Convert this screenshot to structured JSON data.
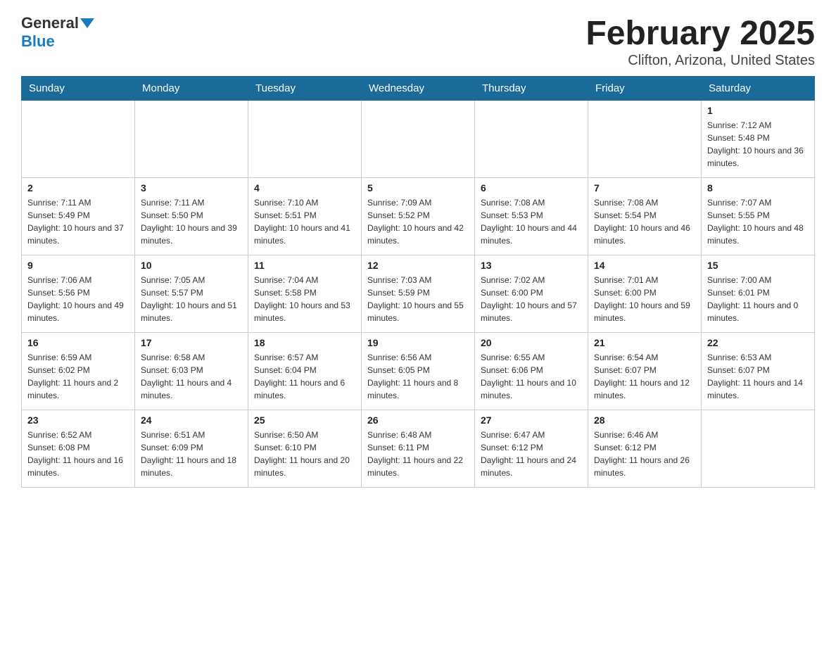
{
  "header": {
    "logo_general": "General",
    "logo_blue": "Blue",
    "month_title": "February 2025",
    "location": "Clifton, Arizona, United States"
  },
  "days_of_week": [
    "Sunday",
    "Monday",
    "Tuesday",
    "Wednesday",
    "Thursday",
    "Friday",
    "Saturday"
  ],
  "weeks": [
    [
      {
        "day": "",
        "info": ""
      },
      {
        "day": "",
        "info": ""
      },
      {
        "day": "",
        "info": ""
      },
      {
        "day": "",
        "info": ""
      },
      {
        "day": "",
        "info": ""
      },
      {
        "day": "",
        "info": ""
      },
      {
        "day": "1",
        "info": "Sunrise: 7:12 AM\nSunset: 5:48 PM\nDaylight: 10 hours and 36 minutes."
      }
    ],
    [
      {
        "day": "2",
        "info": "Sunrise: 7:11 AM\nSunset: 5:49 PM\nDaylight: 10 hours and 37 minutes."
      },
      {
        "day": "3",
        "info": "Sunrise: 7:11 AM\nSunset: 5:50 PM\nDaylight: 10 hours and 39 minutes."
      },
      {
        "day": "4",
        "info": "Sunrise: 7:10 AM\nSunset: 5:51 PM\nDaylight: 10 hours and 41 minutes."
      },
      {
        "day": "5",
        "info": "Sunrise: 7:09 AM\nSunset: 5:52 PM\nDaylight: 10 hours and 42 minutes."
      },
      {
        "day": "6",
        "info": "Sunrise: 7:08 AM\nSunset: 5:53 PM\nDaylight: 10 hours and 44 minutes."
      },
      {
        "day": "7",
        "info": "Sunrise: 7:08 AM\nSunset: 5:54 PM\nDaylight: 10 hours and 46 minutes."
      },
      {
        "day": "8",
        "info": "Sunrise: 7:07 AM\nSunset: 5:55 PM\nDaylight: 10 hours and 48 minutes."
      }
    ],
    [
      {
        "day": "9",
        "info": "Sunrise: 7:06 AM\nSunset: 5:56 PM\nDaylight: 10 hours and 49 minutes."
      },
      {
        "day": "10",
        "info": "Sunrise: 7:05 AM\nSunset: 5:57 PM\nDaylight: 10 hours and 51 minutes."
      },
      {
        "day": "11",
        "info": "Sunrise: 7:04 AM\nSunset: 5:58 PM\nDaylight: 10 hours and 53 minutes."
      },
      {
        "day": "12",
        "info": "Sunrise: 7:03 AM\nSunset: 5:59 PM\nDaylight: 10 hours and 55 minutes."
      },
      {
        "day": "13",
        "info": "Sunrise: 7:02 AM\nSunset: 6:00 PM\nDaylight: 10 hours and 57 minutes."
      },
      {
        "day": "14",
        "info": "Sunrise: 7:01 AM\nSunset: 6:00 PM\nDaylight: 10 hours and 59 minutes."
      },
      {
        "day": "15",
        "info": "Sunrise: 7:00 AM\nSunset: 6:01 PM\nDaylight: 11 hours and 0 minutes."
      }
    ],
    [
      {
        "day": "16",
        "info": "Sunrise: 6:59 AM\nSunset: 6:02 PM\nDaylight: 11 hours and 2 minutes."
      },
      {
        "day": "17",
        "info": "Sunrise: 6:58 AM\nSunset: 6:03 PM\nDaylight: 11 hours and 4 minutes."
      },
      {
        "day": "18",
        "info": "Sunrise: 6:57 AM\nSunset: 6:04 PM\nDaylight: 11 hours and 6 minutes."
      },
      {
        "day": "19",
        "info": "Sunrise: 6:56 AM\nSunset: 6:05 PM\nDaylight: 11 hours and 8 minutes."
      },
      {
        "day": "20",
        "info": "Sunrise: 6:55 AM\nSunset: 6:06 PM\nDaylight: 11 hours and 10 minutes."
      },
      {
        "day": "21",
        "info": "Sunrise: 6:54 AM\nSunset: 6:07 PM\nDaylight: 11 hours and 12 minutes."
      },
      {
        "day": "22",
        "info": "Sunrise: 6:53 AM\nSunset: 6:07 PM\nDaylight: 11 hours and 14 minutes."
      }
    ],
    [
      {
        "day": "23",
        "info": "Sunrise: 6:52 AM\nSunset: 6:08 PM\nDaylight: 11 hours and 16 minutes."
      },
      {
        "day": "24",
        "info": "Sunrise: 6:51 AM\nSunset: 6:09 PM\nDaylight: 11 hours and 18 minutes."
      },
      {
        "day": "25",
        "info": "Sunrise: 6:50 AM\nSunset: 6:10 PM\nDaylight: 11 hours and 20 minutes."
      },
      {
        "day": "26",
        "info": "Sunrise: 6:48 AM\nSunset: 6:11 PM\nDaylight: 11 hours and 22 minutes."
      },
      {
        "day": "27",
        "info": "Sunrise: 6:47 AM\nSunset: 6:12 PM\nDaylight: 11 hours and 24 minutes."
      },
      {
        "day": "28",
        "info": "Sunrise: 6:46 AM\nSunset: 6:12 PM\nDaylight: 11 hours and 26 minutes."
      },
      {
        "day": "",
        "info": ""
      }
    ]
  ]
}
